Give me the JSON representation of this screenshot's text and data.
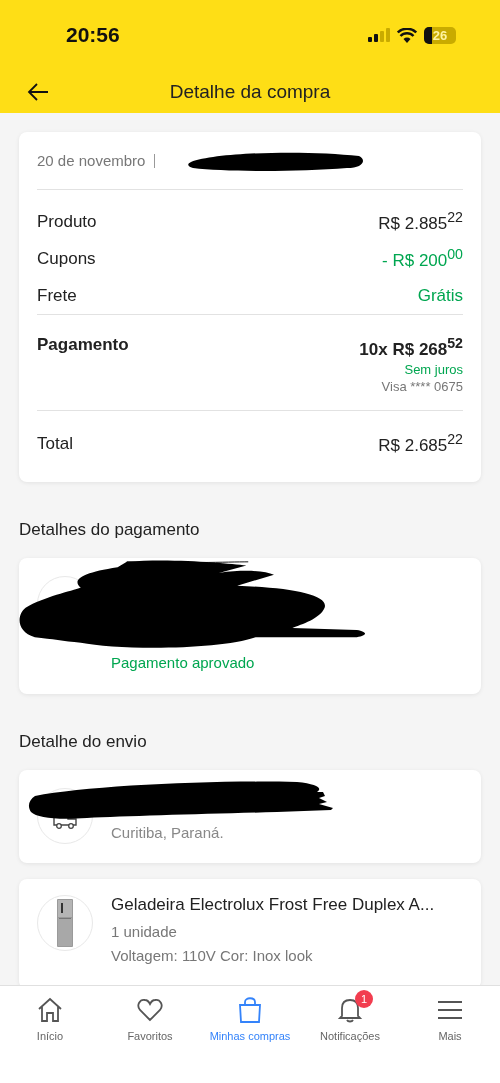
{
  "status_bar": {
    "time": "20:56",
    "battery": "26"
  },
  "header": {
    "title": "Detalhe da compra"
  },
  "summary": {
    "date": "20 de novembro",
    "lines": [
      {
        "label": "Produto",
        "value": "R$ 2.885$^{22}$",
        "kind": "normal"
      },
      {
        "label": "Cupons",
        "value": "- R$ 200$^{00}$",
        "kind": "discount"
      },
      {
        "label": "Frete",
        "value": "Grátis",
        "kind": "discount"
      }
    ],
    "payment": {
      "label": "Pagamento",
      "value": "10x R$ 268$^{52}$",
      "note": "Sem juros",
      "card": "Visa **** 0675"
    },
    "total": {
      "label": "Total",
      "value": "R$ 2.685$^{22}$"
    }
  },
  "payment_details": {
    "heading": "Detalhes do pagamento",
    "status": "Pagamento aprovado"
  },
  "shipping": {
    "heading": "Detalhe do envio",
    "address": "Curitiba, Paraná."
  },
  "product": {
    "name": "Geladeira Electrolux Frost Free Duplex A...",
    "quantity": "1 unidade",
    "variant": "Voltagem: 110V Cor: Inox look"
  },
  "nav": [
    {
      "label": "Início",
      "kind": "home",
      "selected": false
    },
    {
      "label": "Favoritos",
      "kind": "heart",
      "selected": false
    },
    {
      "label": "Minhas compras",
      "kind": "bag",
      "selected": true
    },
    {
      "label": "Notificações",
      "kind": "bell",
      "selected": false,
      "badge": "1"
    },
    {
      "label": "Mais",
      "kind": "menu",
      "selected": false
    }
  ]
}
